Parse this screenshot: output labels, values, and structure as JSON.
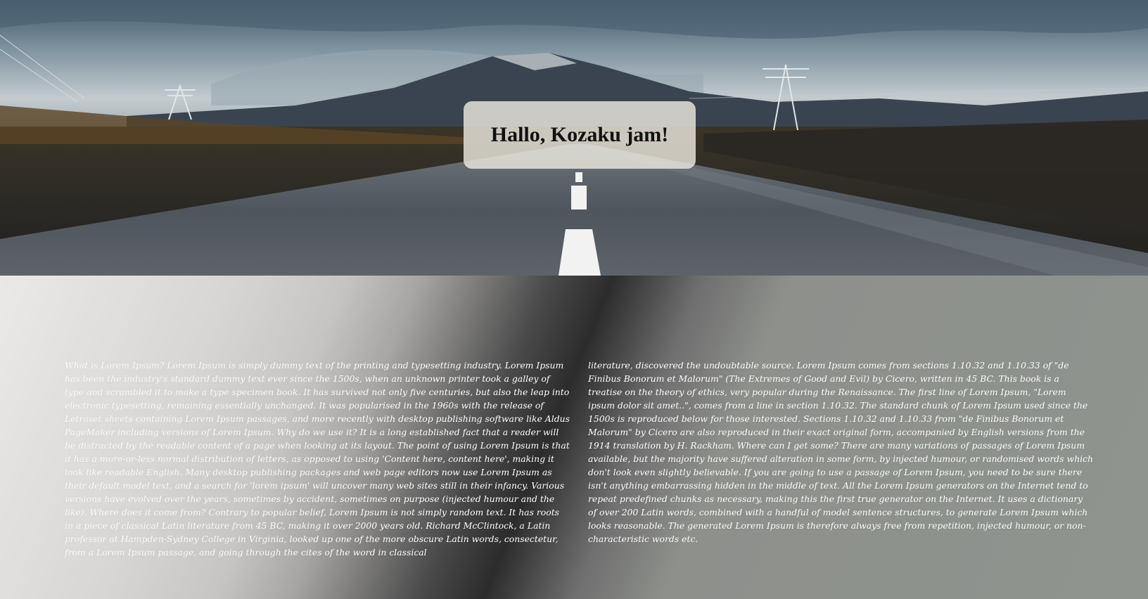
{
  "hero": {
    "title": "Hallo, Kozaku jam!"
  },
  "content": {
    "column_left": "What is Lorem Ipsum? Lorem Ipsum is simply dummy text of the printing and typesetting industry. Lorem Ipsum has been the industry's standard dummy text ever since the 1500s, when an unknown printer took a galley of type and scrambled it to make a type specimen book. It has survived not only five centuries, but also the leap into electronic typesetting, remaining essentially unchanged. It was popularised in the 1960s with the release of Letraset sheets containing Lorem Ipsum passages, and more recently with desktop publishing software like Aldus PageMaker including versions of Lorem Ipsum. Why do we use it? It is a long established fact that a reader will be distracted by the readable content of a page when looking at its layout. The point of using Lorem Ipsum is that it has a more-or-less normal distribution of letters, as opposed to using 'Content here, content here', making it look like readable English. Many desktop publishing packages and web page editors now use Lorem Ipsum as their default model text, and a search for 'lorem ipsum' will uncover many web sites still in their infancy. Various versions have evolved over the years, sometimes by accident, sometimes on purpose (injected humour and the like). Where does it come from? Contrary to popular belief, Lorem Ipsum is not simply random text. It has roots in a piece of classical Latin literature from 45 BC, making it over 2000 years old. Richard McClintock, a Latin professor at Hampden-Sydney College in Virginia, looked up one of the more obscure Latin words, consectetur, from a Lorem Ipsum passage, and going through the cites of the word in classical",
    "column_right": "literature, discovered the undoubtable source. Lorem Ipsum comes from sections 1.10.32 and 1.10.33 of \"de Finibus Bonorum et Malorum\" (The Extremes of Good and Evil) by Cicero, written in 45 BC. This book is a treatise on the theory of ethics, very popular during the Renaissance. The first line of Lorem Ipsum, \"Lorem ipsum dolor sit amet..\", comes from a line in section 1.10.32. The standard chunk of Lorem Ipsum used since the 1500s is reproduced below for those interested. Sections 1.10.32 and 1.10.33 from \"de Finibus Bonorum et Malorum\" by Cicero are also reproduced in their exact original form, accompanied by English versions from the 1914 translation by H. Rackham. Where can I get some? There are many variations of passages of Lorem Ipsum available, but the majority have suffered alteration in some form, by injected humour, or randomised words which don't look even slightly believable. If you are going to use a passage of Lorem Ipsum, you need to be sure there isn't anything embarrassing hidden in the middle of text. All the Lorem Ipsum generators on the Internet tend to repeat predefined chunks as necessary, making this the first true generator on the Internet. It uses a dictionary of over 200 Latin words, combined with a handful of model sentence structures, to generate Lorem Ipsum which looks reasonable. The generated Lorem Ipsum is therefore always free from repetition, injected humour, or non-characteristic words etc."
  }
}
